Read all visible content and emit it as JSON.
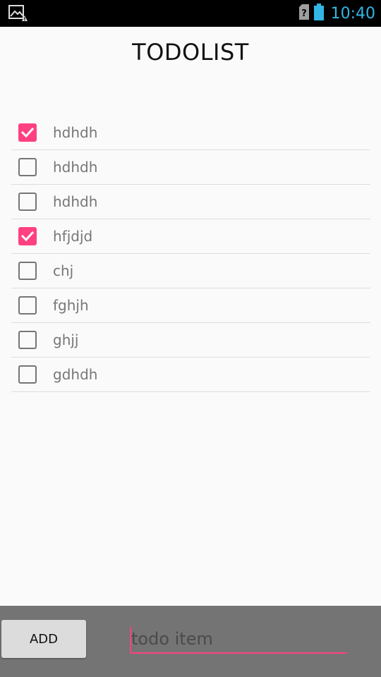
{
  "status_bar": {
    "time": "10:40",
    "left_icon": "image-alert-icon",
    "sim_icon": "sim-unknown-icon",
    "battery_icon": "battery-icon",
    "clock_color": "#33b5e5"
  },
  "app": {
    "title": "TODOLIST"
  },
  "todo_items": [
    {
      "text": "hdhdh",
      "checked": true
    },
    {
      "text": "hdhdh",
      "checked": false
    },
    {
      "text": "hdhdh",
      "checked": false
    },
    {
      "text": "hfjdjd",
      "checked": true
    },
    {
      "text": "chj",
      "checked": false
    },
    {
      "text": "fghjh",
      "checked": false
    },
    {
      "text": "ghjj",
      "checked": false
    },
    {
      "text": "gdhdh",
      "checked": false
    }
  ],
  "input_bar": {
    "add_label": "ADD",
    "placeholder": "todo item",
    "value": ""
  },
  "colors": {
    "accent": "#ff4081",
    "bottom_bar": "#747474",
    "background": "#fafafa"
  }
}
